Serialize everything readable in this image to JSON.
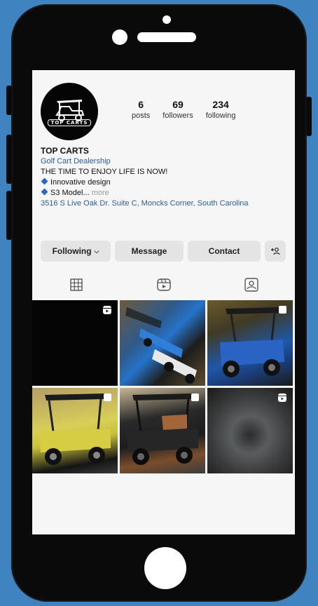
{
  "colors": {
    "background": "#3f84c0",
    "phone": "#0a0a0a",
    "screen": "#f6f6f6",
    "link": "#2b5d9a",
    "accent": "#2a6ac6"
  },
  "profile": {
    "avatar_text": "TOP CARTS",
    "stats": [
      {
        "value": "6",
        "label": "posts"
      },
      {
        "value": "69",
        "label": "followers"
      },
      {
        "value": "234",
        "label": "following"
      }
    ]
  },
  "bio": {
    "name": "TOP CARTS",
    "category": "Golf Cart Dealership",
    "tagline": "THE TIME TO ENJOY LIFE IS NOW!",
    "bullet1": "Innovative design",
    "bullet2": "S3 Model...",
    "more": " more",
    "address": "3516 S Live Oak Dr. Suite C, Moncks Corner, South Carolina"
  },
  "actions": {
    "following": "Following",
    "message": "Message",
    "contact": "Contact",
    "add_person": "+Α"
  },
  "tabs": [
    "grid-icon",
    "reels-icon",
    "tagged-icon"
  ],
  "grid": {
    "icons": [
      "reel-icon",
      "none",
      "multi-icon",
      "multi-icon",
      "multi-icon",
      "reel-icon"
    ]
  }
}
